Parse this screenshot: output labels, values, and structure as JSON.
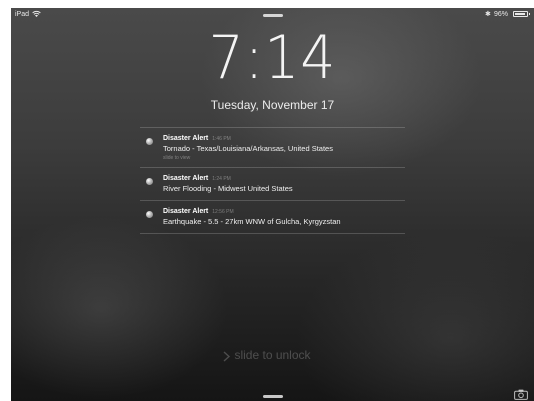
{
  "status_bar": {
    "carrier": "iPad",
    "wifi_icon": "wifi-icon",
    "bluetooth_icon": "bluetooth-icon",
    "battery_percent": "96%",
    "battery_level": 0.96
  },
  "lock_screen": {
    "time": "7:14",
    "date": "Tuesday, November 17"
  },
  "notifications": [
    {
      "app": "Disaster Alert",
      "time": "1:46 PM",
      "body": "Tornado - Texas/Louisiana/Arkansas, United States",
      "subtext": "slide to view"
    },
    {
      "app": "Disaster Alert",
      "time": "1:24 PM",
      "body": "River Flooding - Midwest United States"
    },
    {
      "app": "Disaster Alert",
      "time": "12:56 PM",
      "body": "Earthquake - 5.5 - 27km WNW of Gulcha, Kyrgyzstan"
    }
  ],
  "unlock": {
    "label": "slide to unlock",
    "icon": "chevron-right-icon"
  },
  "camera": {
    "icon": "camera-icon"
  },
  "colors": {
    "background": "#3a3a3a",
    "text": "#ffffff"
  }
}
